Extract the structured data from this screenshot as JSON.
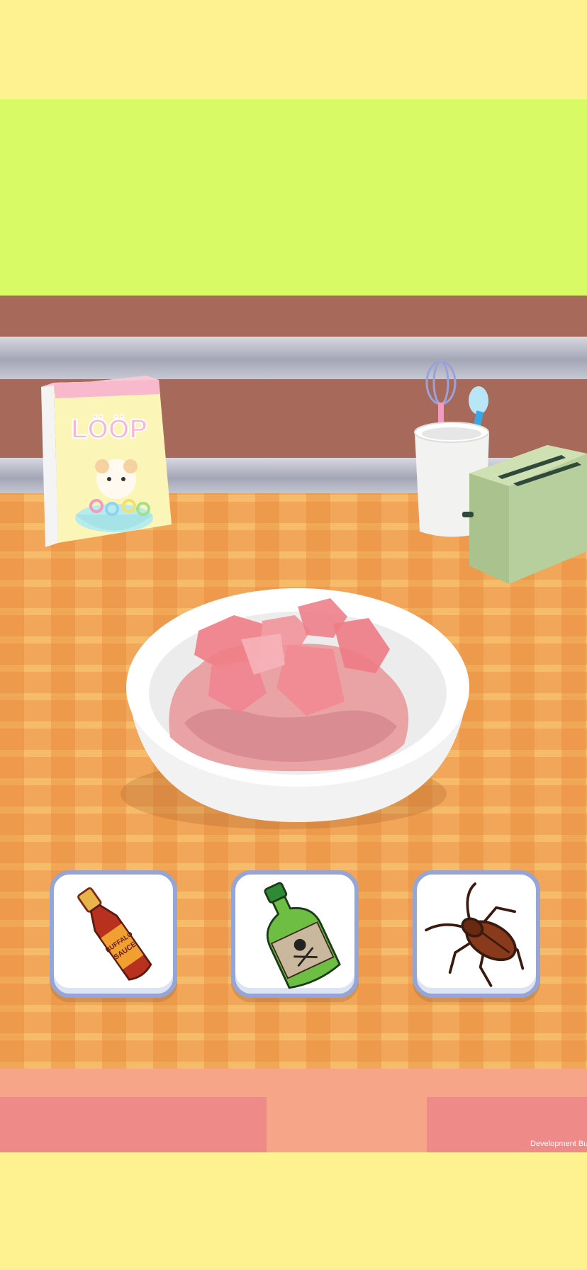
{
  "scene": {
    "cereal_box": {
      "brand": "LÖÖP"
    },
    "bowl_contents": "meat-with-ice-chunks"
  },
  "choices": [
    {
      "icon": "hot-sauce-bottle-icon",
      "label_line1": "BUFFALO",
      "label_line2": "SAUCE"
    },
    {
      "icon": "poison-bottle-icon"
    },
    {
      "icon": "cockroach-icon"
    }
  ],
  "footer": {
    "dev_build_text": "Development Build"
  },
  "colors": {
    "wall": "#d7fa65",
    "backsplash": "#a6695a",
    "counter": "#f2a659",
    "frame": "#fef190",
    "choice_border": "#95a5d6"
  }
}
